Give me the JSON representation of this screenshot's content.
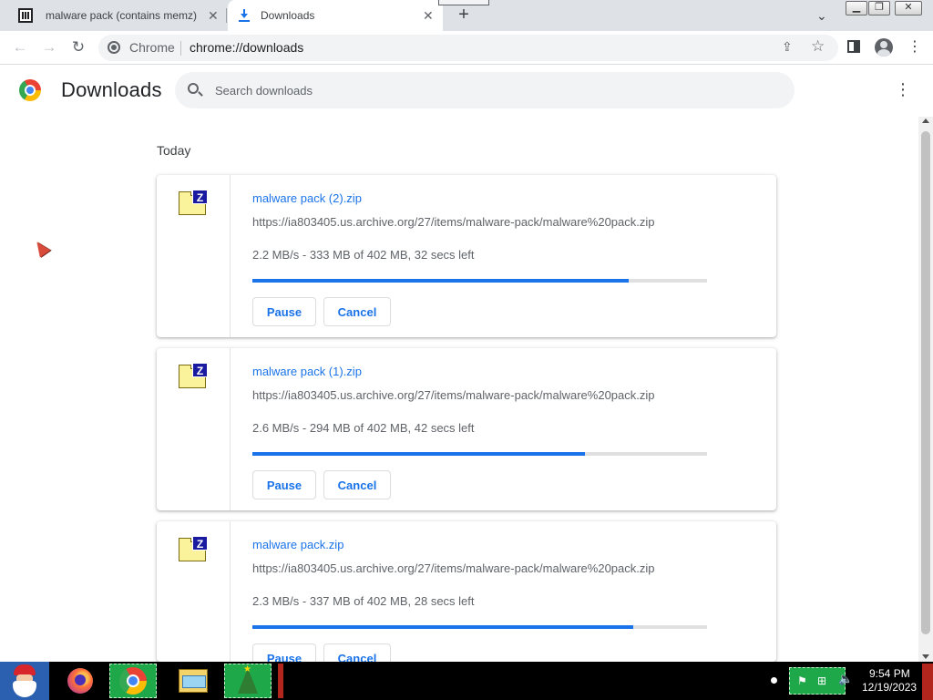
{
  "browser": {
    "tabs": [
      {
        "title": "malware pack (contains memz) :",
        "close": "✕"
      },
      {
        "title": "Downloads",
        "close": "✕"
      }
    ],
    "new_tab_label": "+",
    "tab_search_icon": "chevron-down-icon",
    "window_buttons": {
      "minimize": "▁",
      "maximize": "❐",
      "close": "✕"
    },
    "nav": {
      "back": "←",
      "forward": "→",
      "reload": "↻"
    },
    "omnibox": {
      "chip": "Chrome",
      "url": "chrome://downloads",
      "share_icon": "share-icon",
      "star_icon": "bookmark-star-icon"
    },
    "menu_glyph": "⋮"
  },
  "page": {
    "title": "Downloads",
    "search_placeholder": "Search downloads",
    "menu_glyph": "⋮",
    "section_date": "Today"
  },
  "downloads": [
    {
      "file_name": "malware pack (2).zip",
      "url": "https://ia803405.us.archive.org/27/items/malware-pack/malware%20pack.zip",
      "status": "2.2 MB/s - 333 MB of 402 MB, 32 secs left",
      "progress_fraction": 0.828,
      "pause_label": "Pause",
      "cancel_label": "Cancel"
    },
    {
      "file_name": "malware pack (1).zip",
      "url": "https://ia803405.us.archive.org/27/items/malware-pack/malware%20pack.zip",
      "status": "2.6 MB/s - 294 MB of 402 MB, 42 secs left",
      "progress_fraction": 0.731,
      "pause_label": "Pause",
      "cancel_label": "Cancel"
    },
    {
      "file_name": "malware pack.zip",
      "url": "https://ia803405.us.archive.org/27/items/malware-pack/malware%20pack.zip",
      "status": "2.3 MB/s - 337 MB of 402 MB, 28 secs left",
      "progress_fraction": 0.838,
      "pause_label": "Pause",
      "cancel_label": "Cancel"
    }
  ],
  "taskbar": {
    "clock_time": "9:54 PM",
    "clock_date": "12/19/2023",
    "pinned_icons": [
      "santa-start-icon",
      "firefox-icon",
      "chrome-icon",
      "file-explorer-icon",
      "christmas-tree-icon"
    ],
    "tray_icons": [
      "network-error-icon",
      "network-icon",
      "speaker-icon"
    ]
  },
  "colors": {
    "accent": "#1a73e8",
    "tabstrip": "#dee1e6",
    "taskbar": "#000000",
    "taskbar_highlight": "#1fa84a"
  }
}
